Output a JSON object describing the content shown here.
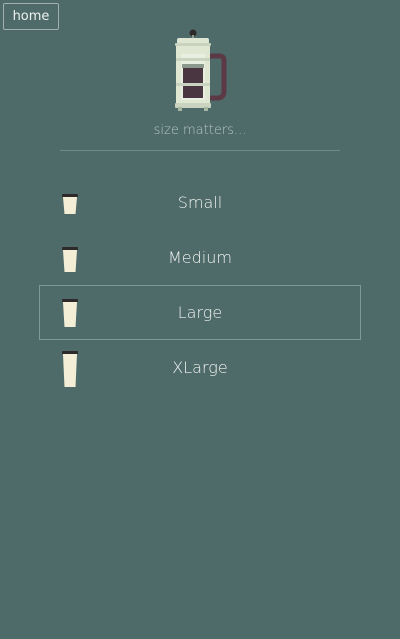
{
  "nav": {
    "home_label": "home"
  },
  "header": {
    "logo_icon": "french-press-icon",
    "tagline": "size matters..."
  },
  "sizes": [
    {
      "label": "Small",
      "icon": "coffee-cup-small-icon",
      "selected": false
    },
    {
      "label": "Medium",
      "icon": "coffee-cup-medium-icon",
      "selected": false
    },
    {
      "label": "Large",
      "icon": "coffee-cup-large-icon",
      "selected": true
    },
    {
      "label": "XLarge",
      "icon": "coffee-cup-xlarge-icon",
      "selected": false
    }
  ],
  "colors": {
    "background": "#4e6b6a",
    "cup": "#f5eed6",
    "cup_lid": "#2e2a2a",
    "press_glass": "#dfe7d3",
    "press_coffee": "#4a3640",
    "press_handle": "#5b3a46",
    "text": "#eef1ee",
    "tagline": "#b8c6c3",
    "selected_border": "#7f9997"
  }
}
